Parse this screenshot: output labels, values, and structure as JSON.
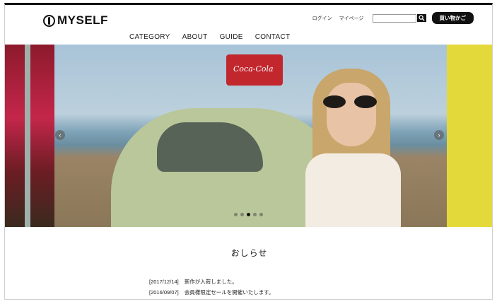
{
  "header": {
    "logo_text": "MYSELF",
    "utility_links": [
      "ログイン",
      "マイページ"
    ],
    "search": {
      "placeholder": "",
      "value": ""
    },
    "cart_label": "買い物かご"
  },
  "global_nav": [
    "CATEGORY",
    "ABOUT",
    "GUIDE",
    "CONTACT"
  ],
  "slider": {
    "cooler_brand": "Coca-Cola",
    "dots_total": 5,
    "active_dot": 3
  },
  "news": {
    "title": "おしらせ",
    "items": [
      {
        "date": "[2017/12/14]",
        "text": "新作が入荷しました。"
      },
      {
        "date": "[2016/09/07]",
        "text": "会員様限定セールを開催いたします。"
      }
    ]
  },
  "colors": {
    "accent": "#111111",
    "cooler_red": "#c1272d",
    "side_yellow": "#e4d93b"
  }
}
